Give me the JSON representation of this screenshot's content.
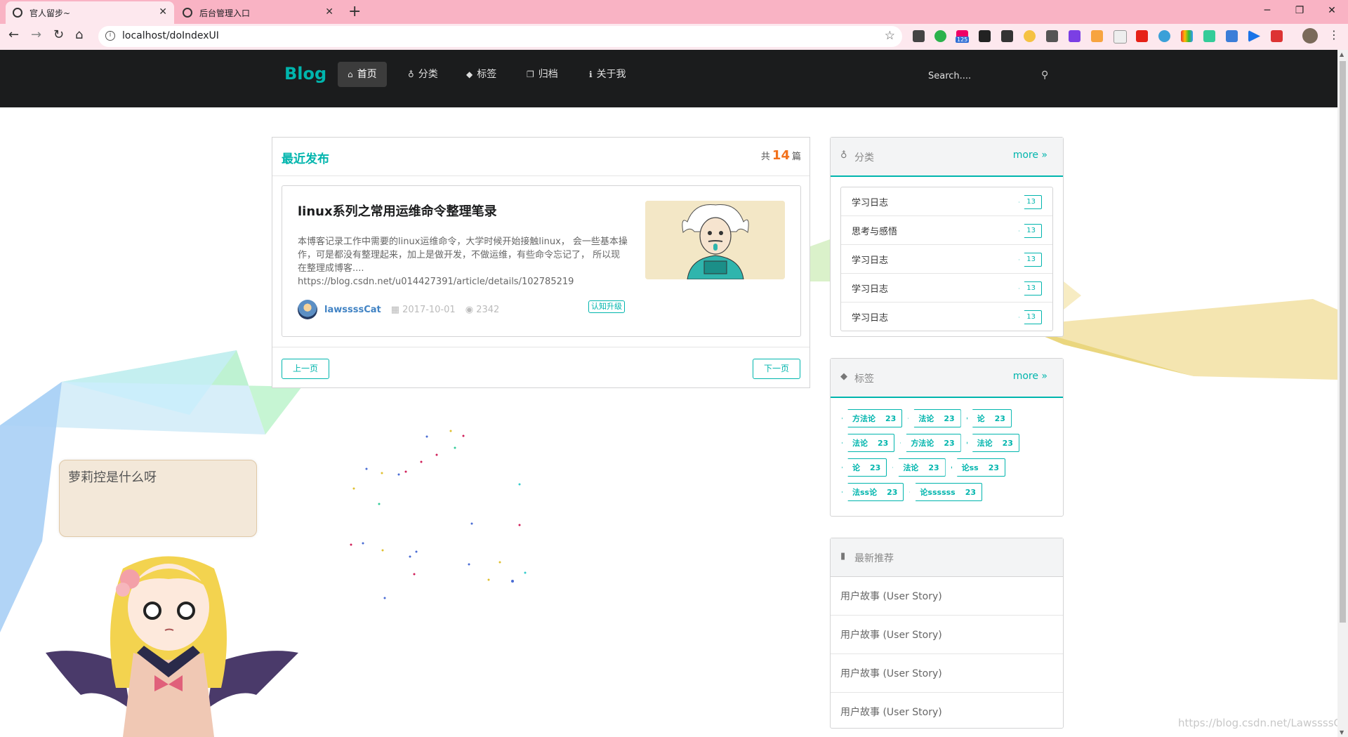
{
  "browser": {
    "tabs": [
      {
        "label": "官人留步~",
        "active": true
      },
      {
        "label": "后台管理入口",
        "active": false
      }
    ],
    "url": "localhost/doIndexUI",
    "extension_badge": "125"
  },
  "nav": {
    "brand": "Blog",
    "items": [
      {
        "icon": "home-icon",
        "label": "首页",
        "active": true
      },
      {
        "icon": "lightbulb-icon",
        "label": "分类",
        "active": false
      },
      {
        "icon": "tags-icon",
        "label": "标签",
        "active": false
      },
      {
        "icon": "archive-icon",
        "label": "归档",
        "active": false
      },
      {
        "icon": "info-icon",
        "label": "关于我",
        "active": false
      }
    ],
    "search_placeholder": "Search...."
  },
  "main": {
    "title": "最近发布",
    "count_prefix": "共",
    "count": "14",
    "count_suffix": "篇",
    "post": {
      "title": "linux系列之常用运维命令整理笔录",
      "description": "本博客记录工作中需要的linux运维命令，大学时候开始接触linux， 会一些基本操作，可是都没有整理起来，加上是做开发，不做运维，有些命令忘记了， 所以现在整理成博客....\nhttps://blog.csdn.net/u014427391/article/details/102785219",
      "author": "lawssssCat",
      "date": "2017-10-01",
      "views": "2342",
      "tag": "认知升级"
    },
    "prev_label": "上一页",
    "next_label": "下一页"
  },
  "categories": {
    "title": "分类",
    "more": "more",
    "items": [
      {
        "name": "学习日志",
        "count": "13"
      },
      {
        "name": "思考与感悟",
        "count": "13"
      },
      {
        "name": "学习日志",
        "count": "13"
      },
      {
        "name": "学习日志",
        "count": "13"
      },
      {
        "name": "学习日志",
        "count": "13"
      }
    ]
  },
  "tags": {
    "title": "标签",
    "more": "more",
    "items": [
      {
        "name": "方法论",
        "count": "23"
      },
      {
        "name": "法论",
        "count": "23"
      },
      {
        "name": "论",
        "count": "23"
      },
      {
        "name": "法论",
        "count": "23"
      },
      {
        "name": "方法论",
        "count": "23"
      },
      {
        "name": "法论",
        "count": "23"
      },
      {
        "name": "论",
        "count": "23"
      },
      {
        "name": "法论",
        "count": "23"
      },
      {
        "name": "论ss",
        "count": "23"
      },
      {
        "name": "法ss论",
        "count": "23"
      },
      {
        "name": "论ssssss",
        "count": "23"
      }
    ]
  },
  "recommend": {
    "title": "最新推荐",
    "items": [
      "用户故事 (User Story)",
      "用户故事 (User Story)",
      "用户故事 (User Story)",
      "用户故事 (User Story)"
    ]
  },
  "mascot_speech": "萝莉控是什么呀",
  "watermark": "https://blog.csdn.net/LawssssCat",
  "colors": {
    "accent": "#00b5ad",
    "nav_bg": "#1b1c1d",
    "count_orange": "#f2711c",
    "tab_strip": "#f9b3c4"
  }
}
